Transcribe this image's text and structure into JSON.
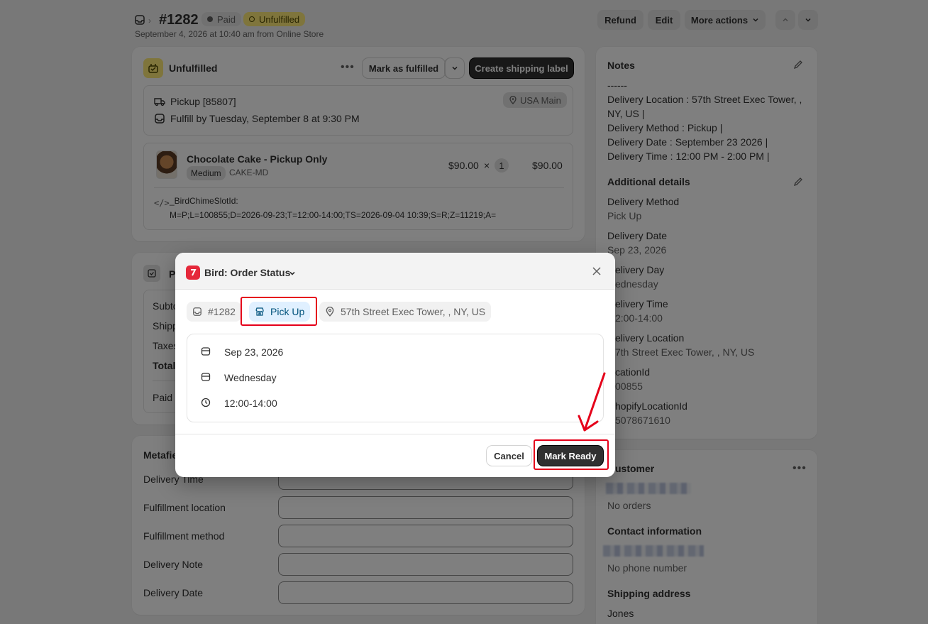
{
  "header": {
    "order_number": "#1282",
    "paid_badge": "Paid",
    "unfulfilled_badge": "Unfulfilled",
    "subtitle": "September 4, 2026 at 10:40 am from Online Store",
    "refund": "Refund",
    "edit": "Edit",
    "more_actions": "More actions"
  },
  "fulfillment": {
    "title": "Unfulfilled",
    "mark_fulfilled": "Mark as fulfilled",
    "create_label": "Create shipping label",
    "pickup": "Pickup [85807]",
    "location_badge": "USA Main",
    "fulfill_by": "Fulfill by Tuesday, September 8 at 9:30 PM",
    "product_name": "Chocolate Cake - Pickup Only",
    "variant": "Medium",
    "sku": "CAKE-MD",
    "unit_price": "$90.00",
    "times": "×",
    "quantity": "1",
    "line_total": "$90.00",
    "prop_key": "_BirdChimeSlotId:",
    "prop_value": "M=P;L=100855;D=2026-09-23;T=12:00-14:00;TS=2026-09-04 10:39;S=R;Z=11219;A="
  },
  "payment": {
    "title_partial": "P",
    "rows": [
      "Subto",
      "Shipp",
      "Taxes",
      "Total"
    ],
    "paid": "Paid"
  },
  "metafields": {
    "title_partial": "Metafie",
    "fields": [
      "Delivery Time",
      "Fulfillment location",
      "Fulfillment method",
      "Delivery Note",
      "Delivery Date"
    ]
  },
  "notes": {
    "title": "Notes",
    "lines": [
      "------",
      "Delivery Location : 57th Street Exec Tower, ,",
      "NY, US |",
      "Delivery Method : Pickup |",
      "Delivery Date : September 23 2026 |",
      "Delivery Time : 12:00 PM - 2:00 PM |"
    ]
  },
  "additional": {
    "title": "Additional details",
    "items": [
      {
        "label": "Delivery Method",
        "value": "Pick Up"
      },
      {
        "label": "Delivery Date",
        "value": "Sep 23, 2026"
      },
      {
        "label": "elivery Day",
        "value": "ednesday"
      },
      {
        "label": "elivery Time",
        "value": "2:00-14:00"
      },
      {
        "label": "elivery Location",
        "value": "7th Street Exec Tower, , NY, US"
      },
      {
        "label": "cationId",
        "value": "00855"
      },
      {
        "label": "hopifyLocationId",
        "value": "5078671610"
      }
    ]
  },
  "customer": {
    "title": "ustomer",
    "no_orders": "No orders",
    "contact_title": "Contact information",
    "no_phone": "No phone number",
    "shipping_title": "Shipping address",
    "shipping_name": "Jones"
  },
  "modal": {
    "title": "Bird: Order Status",
    "order_chip": "#1282",
    "pickup_chip": "Pick Up",
    "location_chip": "57th Street Exec Tower, , NY, US",
    "date": "Sep 23, 2026",
    "day": "Wednesday",
    "time": "12:00-14:00",
    "cancel": "Cancel",
    "mark_ready": "Mark Ready"
  },
  "colors": {
    "accent_red": "#e5001a",
    "dark_button": "#303030",
    "unfulfilled_yellow": "#ffeb78",
    "pickup_blue": "#e0f0ff"
  }
}
